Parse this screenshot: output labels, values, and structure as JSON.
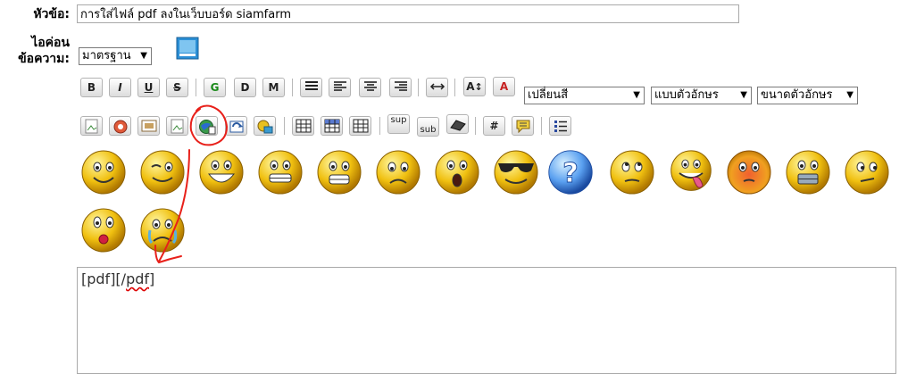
{
  "form": {
    "subject_label": "หัวข้อ:",
    "subject_value": "การใส่ไฟล์ pdf ลงในเว็บบอร์ด siamfarm",
    "icon_label_line1": "ไอค่อน",
    "icon_label_line2": "ข้อความ:",
    "icon_select": "มาตรฐาน"
  },
  "toolbar": {
    "row1": [
      {
        "name": "bold-button",
        "label": "B"
      },
      {
        "name": "italic-button",
        "label": "I"
      },
      {
        "name": "underline-button",
        "label": "U"
      },
      {
        "name": "strikethrough-button",
        "label": "S"
      },
      {
        "name": "glow-button",
        "label": "G"
      },
      {
        "name": "shadow-button",
        "label": "D"
      },
      {
        "name": "move-button",
        "label": "M"
      },
      {
        "name": "preformatted-button",
        "label": ""
      },
      {
        "name": "align-left-button",
        "label": ""
      },
      {
        "name": "align-center-button",
        "label": ""
      },
      {
        "name": "align-right-button",
        "label": ""
      },
      {
        "name": "horizontal-rule-button",
        "label": ""
      },
      {
        "name": "font-size-button",
        "label": "A"
      },
      {
        "name": "font-face-button",
        "label": "A"
      }
    ],
    "color_select": "เปลี่ยนสี",
    "font_select": "แบบตัวอักษร",
    "size_select": "ขนาดตัวอักษร",
    "row2": [
      {
        "name": "insert-image-button",
        "label": ""
      },
      {
        "name": "insert-flash-button",
        "label": ""
      },
      {
        "name": "insert-video-button",
        "label": ""
      },
      {
        "name": "insert-image2-button",
        "label": ""
      },
      {
        "name": "insert-pdf-button",
        "label": ""
      },
      {
        "name": "insert-link-button",
        "label": ""
      },
      {
        "name": "insert-email-button",
        "label": ""
      },
      {
        "name": "table-button",
        "label": ""
      },
      {
        "name": "table-row-button",
        "label": ""
      },
      {
        "name": "table-column-button",
        "label": ""
      },
      {
        "name": "superscript-button",
        "label": "sup"
      },
      {
        "name": "subscript-button",
        "label": "sub"
      },
      {
        "name": "teletype-button",
        "label": ""
      },
      {
        "name": "code-button",
        "label": "#"
      },
      {
        "name": "quote-button",
        "label": ""
      },
      {
        "name": "list-button",
        "label": ""
      }
    ]
  },
  "smileys": [
    "smiley",
    "wink",
    "cheesy",
    "grin",
    "angry",
    "sad",
    "shocked",
    "cool",
    "huh",
    "rolleyes",
    "tongue",
    "embarrassed",
    "lipsrsealed",
    "undecided",
    "kiss",
    "cry"
  ],
  "editor": {
    "text_a": "[pdf][/",
    "text_b": "pdf",
    "text_c": "]"
  },
  "colors": {
    "annotation": "#e8201a",
    "smiley_face": "#f0c010",
    "huh_blue": "#2f7fe0"
  }
}
